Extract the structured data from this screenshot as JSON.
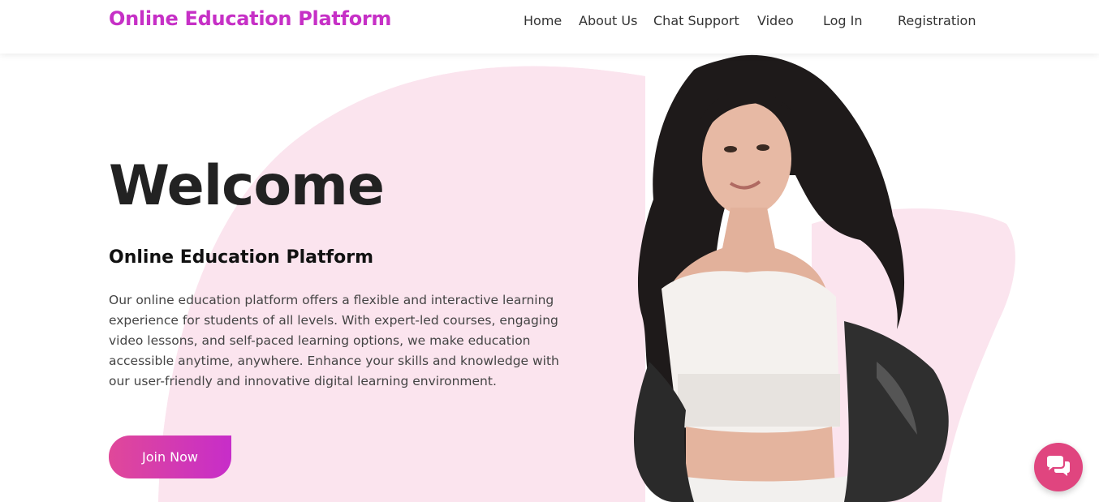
{
  "navbar": {
    "brand": "Online Education Platform",
    "links": [
      "Home",
      "About Us",
      "Chat Support",
      "Video",
      "Log In",
      "Registration"
    ]
  },
  "hero": {
    "title": "Welcome",
    "subtitle": "Online Education Platform",
    "description": "Our online education platform offers a flexible and interactive learning experience for students of all levels. With expert-led courses, engaging video lessons, and self-paced learning options, we make education accessible anytime, anywhere. Enhance your skills and knowledge with our user-friendly and innovative digital learning environment.",
    "cta_label": "Join Now"
  },
  "icons": {
    "chat": "chat-bubbles-icon"
  },
  "colors": {
    "brand": "#c630c6",
    "accent_pink": "#e04899",
    "accent_purple": "#c72dc9",
    "blob": "#fbe4ee",
    "chat_button": "#e0457f"
  }
}
